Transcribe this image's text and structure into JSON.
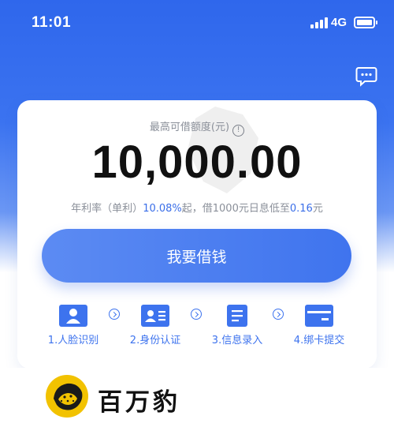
{
  "status_bar": {
    "time": "11:01",
    "network": "4G",
    "battery_level": 1.0
  },
  "header": {
    "message_icon": "chat-bubble-icon"
  },
  "loan_card": {
    "limit_label": "最高可借额度(元)",
    "info_icon_glyph": "!",
    "amount": "10,000.00",
    "rate_prefix": "年利率（单利）",
    "rate_value": "10.08%",
    "rate_middle": "起，借1000元日息低至",
    "daily_value": "0.16",
    "rate_suffix": "元",
    "borrow_button": "我要借钱"
  },
  "steps": [
    {
      "label": "1.人脸识别",
      "icon": "person-icon"
    },
    {
      "label": "2.身份认证",
      "icon": "id-card-icon"
    },
    {
      "label": "3.信息录入",
      "icon": "document-icon"
    },
    {
      "label": "4.绑卡提交",
      "icon": "bank-card-icon"
    }
  ],
  "brand": {
    "name": "百万豹",
    "logo": "leopard-logo"
  },
  "colors": {
    "primary": "#3d73ee",
    "hero_top": "#2f67ec",
    "logo_yellow": "#f2c200"
  }
}
